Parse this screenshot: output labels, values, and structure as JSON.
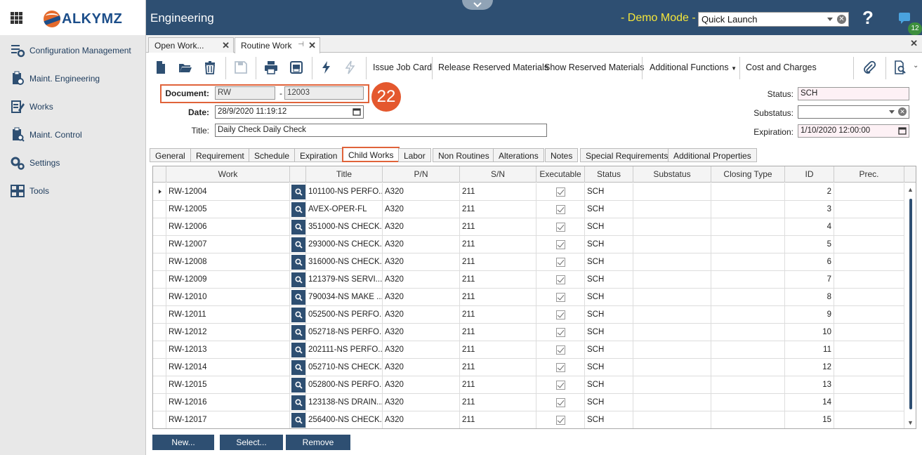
{
  "sidebar": {
    "logo_text": "ALKYMZ",
    "items": [
      {
        "label": "Configuration Management",
        "icon": "gear-list-icon"
      },
      {
        "label": "Maint. Engineering",
        "icon": "clipboard-gear-icon"
      },
      {
        "label": "Works",
        "icon": "edit-list-icon"
      },
      {
        "label": "Maint. Control",
        "icon": "clipboard-search-icon"
      },
      {
        "label": "Settings",
        "icon": "gears-icon"
      },
      {
        "label": "Tools",
        "icon": "tools-grid-icon"
      }
    ]
  },
  "header": {
    "title": "Engineering",
    "demo_mode": "- Demo Mode -",
    "quick_launch": "Quick Launch",
    "help": "?",
    "notification_count": "12"
  },
  "doc_tabs": [
    {
      "label": "Open Work...",
      "active": false
    },
    {
      "label": "Routine Work",
      "active": true
    }
  ],
  "toolbar": {
    "issue_job_card": "Issue Job Card",
    "release_reserved": "Release Reserved Materials",
    "show_reserved": "Show Reserved Materials",
    "additional_functions": "Additional Functions",
    "cost_and_charges": "Cost and Charges"
  },
  "form": {
    "document_label": "Document:",
    "document_prefix": "RW",
    "document_separator": "-",
    "document_number": "12003",
    "date_label": "Date:",
    "date_value": "28/9/2020 11:19:12",
    "title_label": "Title:",
    "title_value": "Daily Check Daily Check",
    "status_label": "Status:",
    "status_value": "SCH",
    "substatus_label": "Substatus:",
    "substatus_value": "",
    "expiration_label": "Expiration:",
    "expiration_value": "1/10/2020 12:00:00",
    "step_number": "22"
  },
  "inner_tabs": [
    "General",
    "Requirement",
    "Schedule",
    "Expiration",
    "Child Works",
    "Labor",
    "Non Routines",
    "Alterations",
    "Notes",
    "Special Requirements",
    "Additional Properties"
  ],
  "active_inner_tab": "Child Works",
  "grid": {
    "columns": [
      "Work",
      "",
      "Title",
      "P/N",
      "S/N",
      "Executable",
      "Status",
      "Substatus",
      "Closing Type",
      "ID",
      "Prec."
    ],
    "rows": [
      {
        "work": "RW-12004",
        "title": "101100-NS PERFO...",
        "pn": "A320",
        "sn": "211",
        "status": "SCH",
        "id": "2"
      },
      {
        "work": "RW-12005",
        "title": "AVEX-OPER-FL",
        "pn": "A320",
        "sn": "211",
        "status": "SCH",
        "id": "3"
      },
      {
        "work": "RW-12006",
        "title": "351000-NS CHECK...",
        "pn": "A320",
        "sn": "211",
        "status": "SCH",
        "id": "4"
      },
      {
        "work": "RW-12007",
        "title": "293000-NS CHECK...",
        "pn": "A320",
        "sn": "211",
        "status": "SCH",
        "id": "5"
      },
      {
        "work": "RW-12008",
        "title": "316000-NS CHECK...",
        "pn": "A320",
        "sn": "211",
        "status": "SCH",
        "id": "6"
      },
      {
        "work": "RW-12009",
        "title": "121379-NS SERVI...",
        "pn": "A320",
        "sn": "211",
        "status": "SCH",
        "id": "7"
      },
      {
        "work": "RW-12010",
        "title": "790034-NS MAKE ...",
        "pn": "A320",
        "sn": "211",
        "status": "SCH",
        "id": "8"
      },
      {
        "work": "RW-12011",
        "title": "052500-NS PERFO...",
        "pn": "A320",
        "sn": "211",
        "status": "SCH",
        "id": "9"
      },
      {
        "work": "RW-12012",
        "title": "052718-NS PERFO...",
        "pn": "A320",
        "sn": "211",
        "status": "SCH",
        "id": "10"
      },
      {
        "work": "RW-12013",
        "title": "202111-NS PERFO...",
        "pn": "A320",
        "sn": "211",
        "status": "SCH",
        "id": "11"
      },
      {
        "work": "RW-12014",
        "title": "052710-NS CHECK...",
        "pn": "A320",
        "sn": "211",
        "status": "SCH",
        "id": "12"
      },
      {
        "work": "RW-12015",
        "title": "052800-NS PERFO...",
        "pn": "A320",
        "sn": "211",
        "status": "SCH",
        "id": "13"
      },
      {
        "work": "RW-12016",
        "title": "123138-NS DRAIN...",
        "pn": "A320",
        "sn": "211",
        "status": "SCH",
        "id": "14"
      },
      {
        "work": "RW-12017",
        "title": "256400-NS CHECK...",
        "pn": "A320",
        "sn": "211",
        "status": "SCH",
        "id": "15"
      }
    ]
  },
  "bottom_buttons": {
    "new": "New...",
    "select": "Select...",
    "remove": "Remove"
  },
  "colors": {
    "header_bg": "#2e4f72",
    "accent": "#e0633a",
    "demo_text": "#f5e63a"
  }
}
